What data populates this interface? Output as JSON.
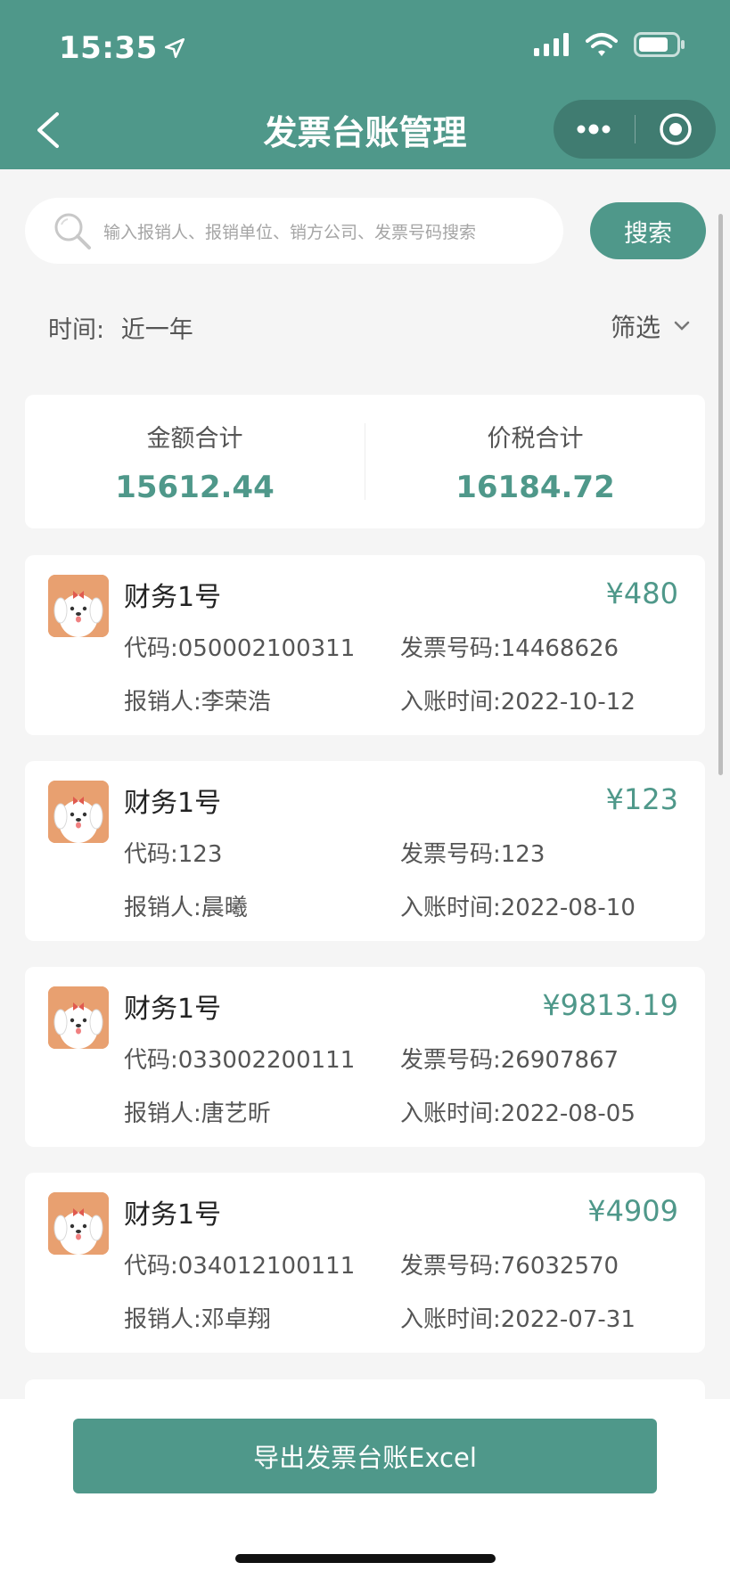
{
  "status_bar": {
    "time": "15:35"
  },
  "nav": {
    "title": "发票台账管理"
  },
  "search": {
    "placeholder": "输入报销人、报销单位、销方公司、发票号码搜索",
    "button_label": "搜索"
  },
  "filter_bar": {
    "time_label": "时间:",
    "time_value": "近一年",
    "filter_label": "筛选"
  },
  "totals": {
    "amount_label": "金额合计",
    "amount_value": "15612.44",
    "tax_label": "价税合计",
    "tax_value": "16184.72"
  },
  "invoices": [
    {
      "name": "财务1号",
      "amount": "¥480",
      "code": "代码:050002100311",
      "number": "发票号码:14468626",
      "person": "报销人:李荣浩",
      "date": "入账时间:2022-10-12"
    },
    {
      "name": "财务1号",
      "amount": "¥123",
      "code": "代码:123",
      "number": "发票号码:123",
      "person": "报销人:晨曦",
      "date": "入账时间:2022-08-10"
    },
    {
      "name": "财务1号",
      "amount": "¥9813.19",
      "code": "代码:033002200111",
      "number": "发票号码:26907867",
      "person": "报销人:唐艺昕",
      "date": "入账时间:2022-08-05"
    },
    {
      "name": "财务1号",
      "amount": "¥4909",
      "code": "代码:034012100111",
      "number": "发票号码:76032570",
      "person": "报销人:邓卓翔",
      "date": "入账时间:2022-07-31"
    }
  ],
  "footer": {
    "export_label": "导出发票台账Excel"
  },
  "colors": {
    "primary": "#4f988a",
    "background": "#f5f5f5",
    "avatar": "#e8a070"
  }
}
